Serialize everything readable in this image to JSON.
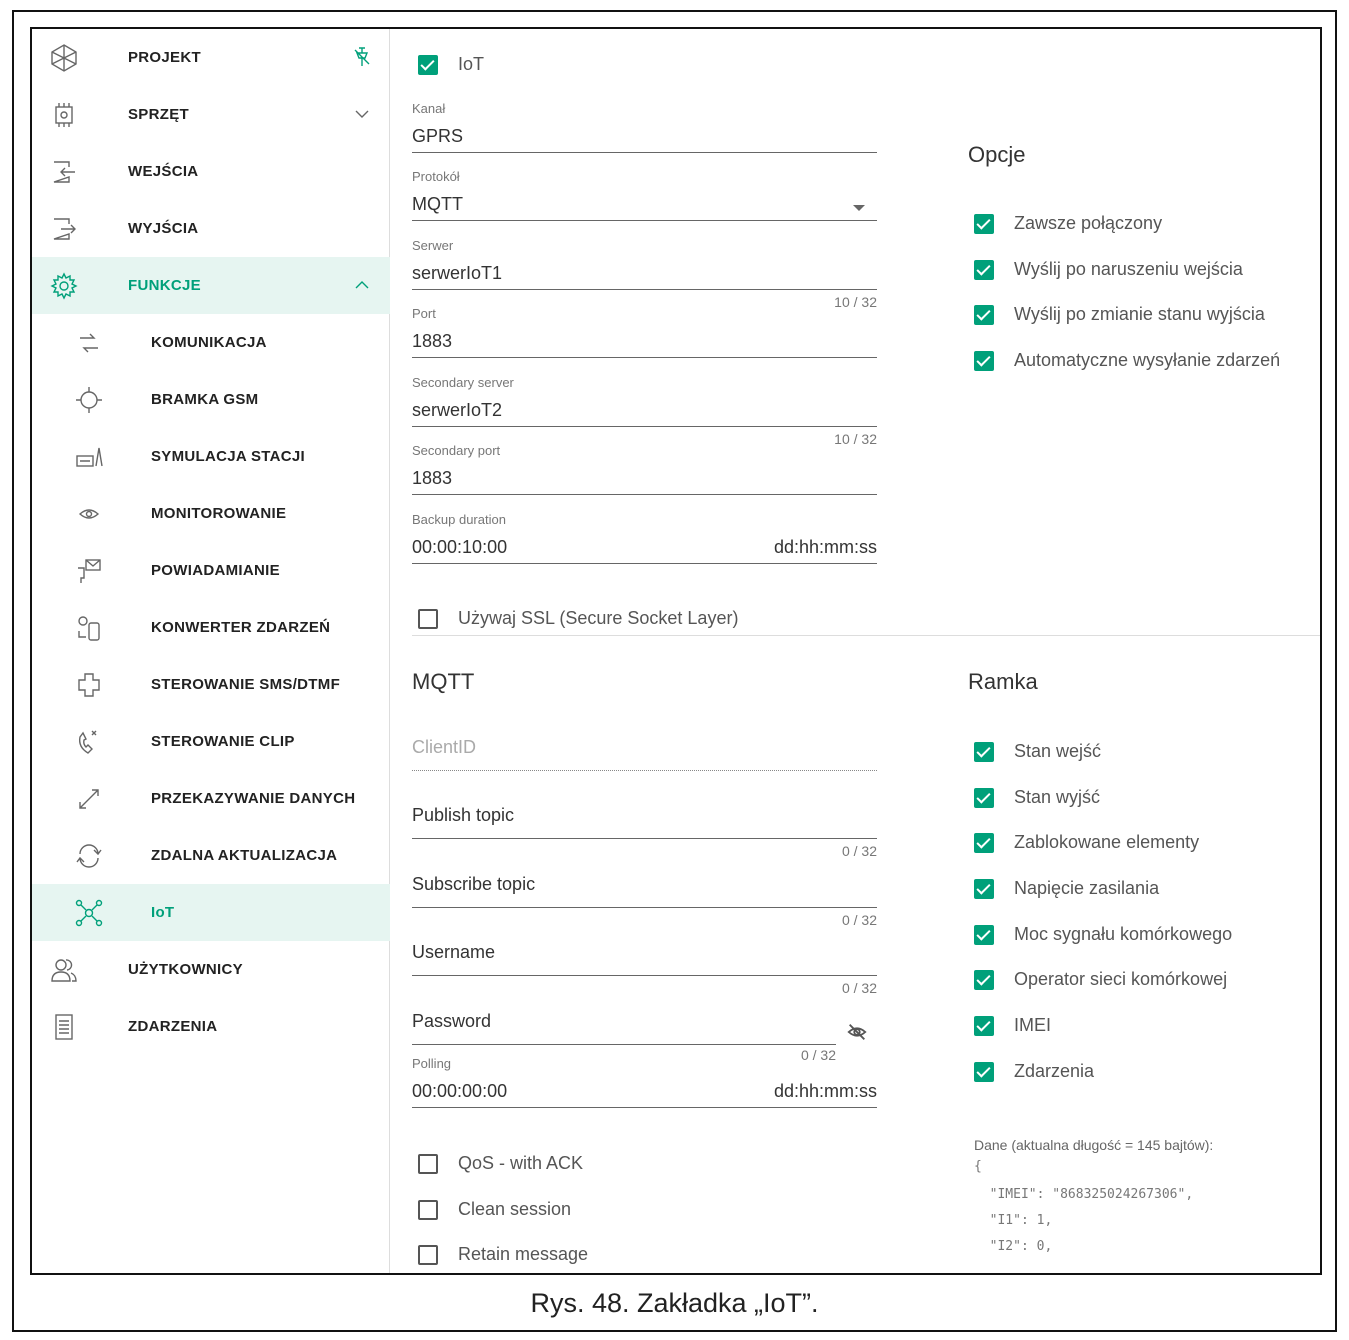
{
  "sidebar": {
    "items": [
      {
        "label": "PROJEKT",
        "icon": "project-icon",
        "trail": "pin-icon"
      },
      {
        "label": "SPRZĘT",
        "icon": "hardware-chip-icon",
        "trail": "chevron-down-icon"
      },
      {
        "label": "WEJŚCIA",
        "icon": "input-icon",
        "trail": ""
      },
      {
        "label": "WYJŚCIA",
        "icon": "output-icon",
        "trail": ""
      },
      {
        "label": "FUNKCJE",
        "icon": "gear-icon",
        "trail": "chevron-up-icon",
        "active": true
      },
      {
        "label": "KOMUNIKACJA",
        "icon": "communication-icon",
        "sub": true
      },
      {
        "label": "BRAMKA GSM",
        "icon": "gsm-icon",
        "sub": true
      },
      {
        "label": "SYMULACJA STACJI",
        "icon": "station-icon",
        "sub": true
      },
      {
        "label": "MONITOROWANIE",
        "icon": "eye-icon",
        "sub": true
      },
      {
        "label": "POWIADAMIANIE",
        "icon": "notification-icon",
        "sub": true
      },
      {
        "label": "KONWERTER ZDARZEŃ",
        "icon": "converter-icon",
        "sub": true
      },
      {
        "label": "STEROWANIE SMS/DTMF",
        "icon": "sms-control-icon",
        "sub": true
      },
      {
        "label": "STEROWANIE CLIP",
        "icon": "clip-icon",
        "sub": true
      },
      {
        "label": "PRZEKAZYWANIE DANYCH",
        "icon": "data-transfer-icon",
        "sub": true
      },
      {
        "label": "ZDALNA AKTUALIZACJA",
        "icon": "update-icon",
        "sub": true
      },
      {
        "label": "IoT",
        "icon": "iot-icon",
        "sub": true,
        "active": true
      },
      {
        "label": "UŻYTKOWNICY",
        "icon": "users-icon"
      },
      {
        "label": "ZDARZENIA",
        "icon": "events-icon"
      }
    ]
  },
  "iot": {
    "label": "IoT",
    "checked": true
  },
  "fields": {
    "kanal": {
      "label": "Kanał",
      "value": "GPRS"
    },
    "protokol": {
      "label": "Protokół",
      "value": "MQTT"
    },
    "serwer": {
      "label": "Serwer",
      "value": "serwerIoT1",
      "counter": "10 / 32"
    },
    "port": {
      "label": "Port",
      "value": "1883"
    },
    "secondary_server": {
      "label": "Secondary server",
      "value": "serwerIoT2",
      "counter": "10 / 32"
    },
    "secondary_port": {
      "label": "Secondary port",
      "value": "1883"
    },
    "backup_duration": {
      "label": "Backup duration",
      "value": "00:00:10:00",
      "suffix": "dd:hh:mm:ss"
    }
  },
  "ssl": {
    "label": "Używaj SSL (Secure Socket Layer)",
    "checked": false
  },
  "opcje": {
    "title": "Opcje",
    "items": [
      "Zawsze połączony",
      "Wyślij po naruszeniu wejścia",
      "Wyślij po zmianie stanu wyjścia",
      "Automatyczne wysyłanie zdarzeń"
    ]
  },
  "mqtt": {
    "title": "MQTT",
    "client_id": {
      "placeholder": "ClientID"
    },
    "publish_topic": {
      "placeholder": "Publish topic",
      "counter": "0 / 32"
    },
    "subscribe_topic": {
      "placeholder": "Subscribe topic",
      "counter": "0 / 32"
    },
    "username": {
      "placeholder": "Username",
      "counter": "0 / 32"
    },
    "password": {
      "placeholder": "Password",
      "counter": "0 / 32"
    },
    "polling": {
      "label": "Polling",
      "value": "00:00:00:00",
      "suffix": "dd:hh:mm:ss"
    },
    "checkboxes": [
      "QoS - with ACK",
      "Clean session",
      "Retain message"
    ]
  },
  "ramka": {
    "title": "Ramka",
    "items": [
      "Stan wejść",
      "Stan wyjść",
      "Zablokowane elementy",
      "Napięcie zasilania",
      "Moc sygnału komórkowego",
      "Operator sieci komórkowej",
      "IMEI",
      "Zdarzenia"
    ],
    "data_label": "Dane (aktualna długość = 145 bajtów):",
    "json_lines": [
      "{",
      "  \"IMEI\": \"868325024267306\",",
      "  \"I1\": 1,",
      "  \"I2\": 0,"
    ]
  },
  "caption": "Rys. 48. Zakładka „IoT”.",
  "colors": {
    "accent": "#00a07a",
    "active_bg": "#e6f5f1"
  }
}
